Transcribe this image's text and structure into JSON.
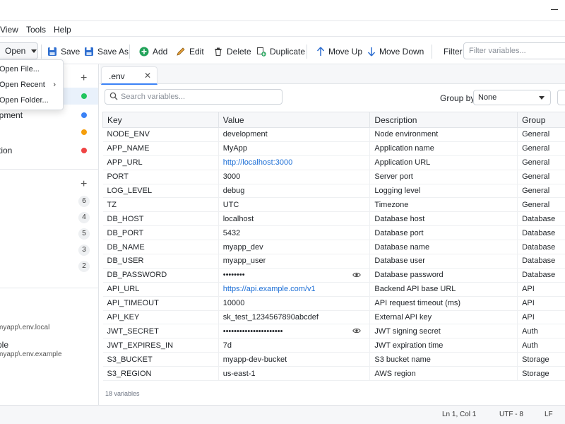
{
  "menu": [
    "View",
    "Tools",
    "Help"
  ],
  "toolbar": {
    "open": "Open",
    "save": "Save",
    "save_as": "Save As",
    "add": "Add",
    "edit": "Edit",
    "delete": "Delete",
    "duplicate": "Duplicate",
    "move_up": "Move Up",
    "move_down": "Move Down",
    "filter_label": "Filter",
    "filter_placeholder": "Filter variables..."
  },
  "open_menu": [
    "Open File...",
    "Open Recent",
    "Open Folder..."
  ],
  "sidebar": {
    "environments": [
      {
        "label": "",
        "color": "#22c55e",
        "active": true
      },
      {
        "label": "opment",
        "color": "#3b82f6"
      },
      {
        "label": "g",
        "color": "#f59e0b"
      },
      {
        "label": "ction",
        "color": "#ef4444"
      }
    ],
    "group_counts": [
      "6",
      "4",
      "5",
      "3",
      "2"
    ],
    "recent": [
      {
        "name": "",
        "path": "myapp\\.env.local"
      },
      {
        "name": "ple",
        "path": "myapp\\.env.example"
      }
    ]
  },
  "tab": {
    "label": ".env"
  },
  "search": {
    "placeholder": "Search variables..."
  },
  "group_by": {
    "label": "Group by:",
    "value": "None"
  },
  "table": {
    "headers": [
      "Key",
      "Value",
      "Description",
      "Group"
    ],
    "rows": [
      {
        "key": "NODE_ENV",
        "value": "development",
        "desc": "Node environment",
        "group": "General"
      },
      {
        "key": "APP_NAME",
        "value": "MyApp",
        "desc": "Application name",
        "group": "General"
      },
      {
        "key": "APP_URL",
        "value": "http://localhost:3000",
        "desc": "Application URL",
        "group": "General",
        "link": true
      },
      {
        "key": "PORT",
        "value": "3000",
        "desc": "Server port",
        "group": "General"
      },
      {
        "key": "LOG_LEVEL",
        "value": "debug",
        "desc": "Logging level",
        "group": "General"
      },
      {
        "key": "TZ",
        "value": "UTC",
        "desc": "Timezone",
        "group": "General"
      },
      {
        "key": "DB_HOST",
        "value": "localhost",
        "desc": "Database host",
        "group": "Database"
      },
      {
        "key": "DB_PORT",
        "value": "5432",
        "desc": "Database port",
        "group": "Database"
      },
      {
        "key": "DB_NAME",
        "value": "myapp_dev",
        "desc": "Database name",
        "group": "Database"
      },
      {
        "key": "DB_USER",
        "value": "myapp_user",
        "desc": "Database user",
        "group": "Database"
      },
      {
        "key": "DB_PASSWORD",
        "value": "••••••••",
        "desc": "Database password",
        "group": "Database",
        "secret": true
      },
      {
        "key": "API_URL",
        "value": "https://api.example.com/v1",
        "desc": "Backend API base URL",
        "group": "API",
        "link": true
      },
      {
        "key": "API_TIMEOUT",
        "value": "10000",
        "desc": "API request timeout (ms)",
        "group": "API"
      },
      {
        "key": "API_KEY",
        "value": "sk_test_1234567890abcdef",
        "desc": "External API key",
        "group": "API"
      },
      {
        "key": "JWT_SECRET",
        "value": "••••••••••••••••••••••",
        "desc": "JWT signing secret",
        "group": "Auth",
        "secret": true
      },
      {
        "key": "JWT_EXPIRES_IN",
        "value": "7d",
        "desc": "JWT expiration time",
        "group": "Auth"
      },
      {
        "key": "S3_BUCKET",
        "value": "myapp-dev-bucket",
        "desc": "S3 bucket name",
        "group": "Storage"
      },
      {
        "key": "S3_REGION",
        "value": "us-east-1",
        "desc": "AWS region",
        "group": "Storage"
      }
    ]
  },
  "count": "18 variables",
  "status": {
    "position": "Ln 1, Col 1",
    "encoding": "UTF - 8",
    "eol": "LF"
  }
}
